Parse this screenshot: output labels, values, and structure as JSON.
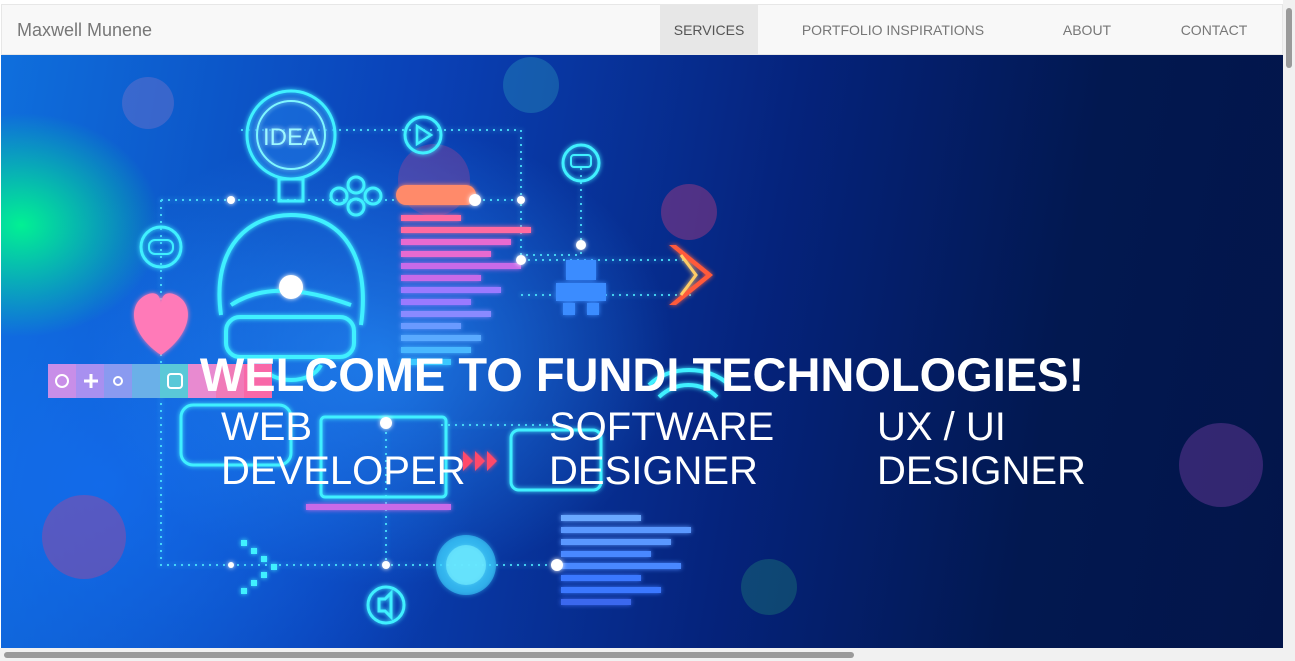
{
  "navbar": {
    "brand": "Maxwell Munene",
    "items": [
      {
        "label": "SERVICES",
        "active": true
      },
      {
        "label": "PORTFOLIO INSPIRATIONS",
        "active": false
      },
      {
        "label": "ABOUT",
        "active": false
      },
      {
        "label": "CONTACT",
        "active": false
      }
    ]
  },
  "hero": {
    "title": "WELCOME TO FUNDI TECHNOLOGIES!",
    "roles": [
      {
        "label": "WEB DEVELOPER"
      },
      {
        "label": "SOFTWARE DESIGNER"
      },
      {
        "label": "UX / UI DESIGNER"
      }
    ],
    "illustration": {
      "idea_bulb_text": "IDEA",
      "icons": [
        "lightbulb-icon",
        "play-icon",
        "chat-icon",
        "gamepad-icon",
        "heart-icon",
        "wifi-icon",
        "speaker-icon",
        "robot-icon",
        "code-lines"
      ]
    }
  },
  "colors": {
    "navbar_bg": "#f8f8f8",
    "nav_text": "#777777",
    "nav_active_bg": "#e7e7e7",
    "hero_dark": "#021850",
    "hero_light": "#0f6fdd",
    "neon_cyan": "#3ff0ff",
    "neon_pink": "#ff5aa8"
  }
}
